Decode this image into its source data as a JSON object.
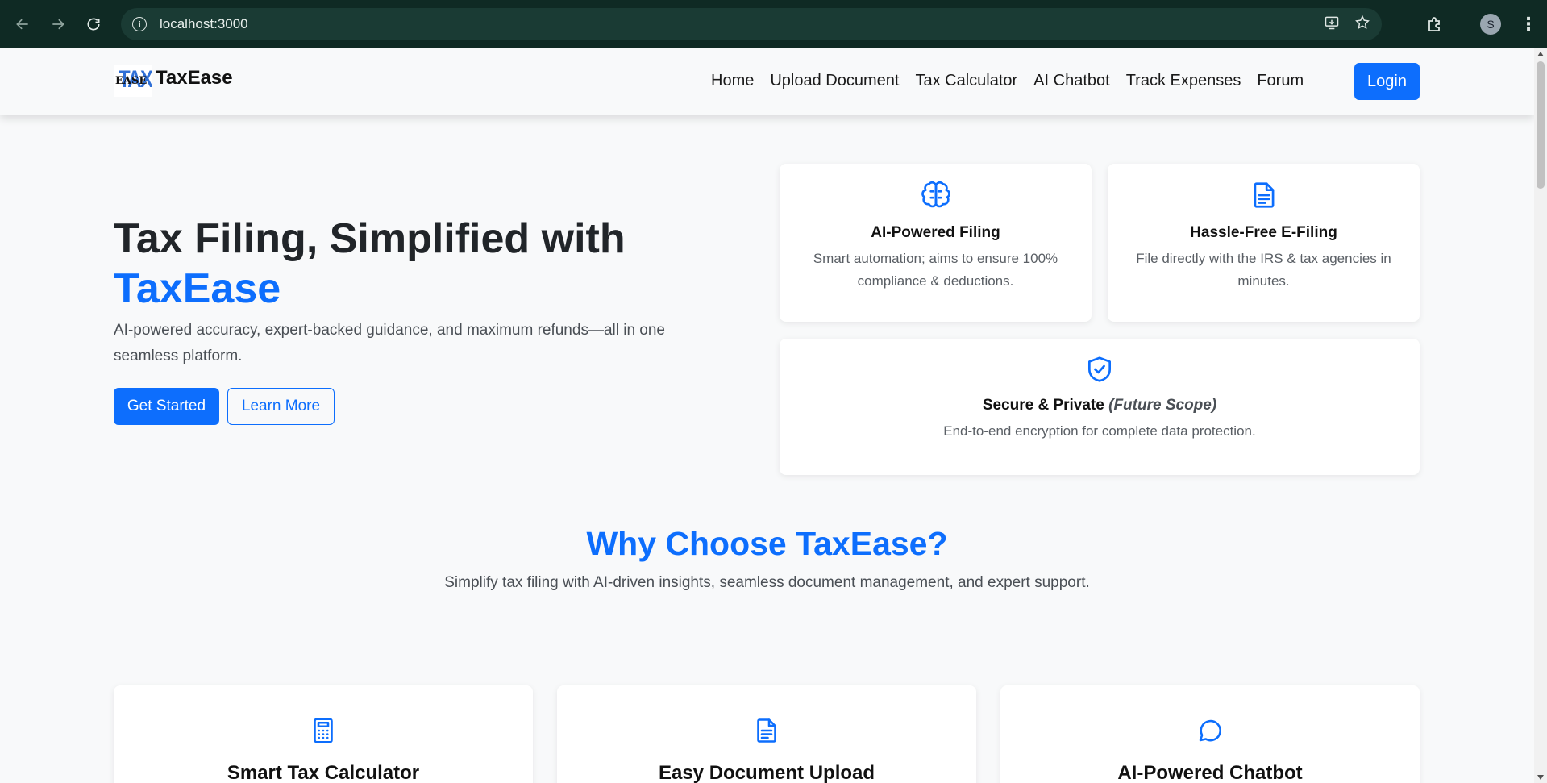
{
  "browser": {
    "url": "localhost:3000",
    "avatar_letter": "S"
  },
  "header": {
    "brand_logo_tax": "TAX",
    "brand_logo_ease": "EASE",
    "brand_name": "TaxEase",
    "nav": [
      "Home",
      "Upload Document",
      "Tax Calculator",
      "AI Chatbot",
      "Track Expenses",
      "Forum"
    ],
    "login_label": "Login"
  },
  "hero": {
    "title_line1": "Tax Filing, Simplified with",
    "title_accent": "TaxEase",
    "subtitle": "AI-powered accuracy, expert-backed guidance, and maximum refunds—all in one seamless platform.",
    "primary_button": "Get Started",
    "secondary_button": "Learn More"
  },
  "hero_cards": [
    {
      "title": "AI-Powered Filing",
      "desc": "Smart automation; aims to ensure 100% compliance & deductions.",
      "icon": "brain-icon"
    },
    {
      "title": "Hassle-Free E-Filing",
      "desc": "File directly with the IRS & tax agencies in minutes.",
      "icon": "document-icon"
    },
    {
      "title": "Secure & Private",
      "title_note": "(Future Scope)",
      "desc": "End-to-end encryption for complete data protection.",
      "icon": "shield-check-icon"
    }
  ],
  "why": {
    "title": "Why Choose TaxEase?",
    "subtitle": "Simplify tax filing with AI-driven insights, seamless document management, and expert support.",
    "features": [
      {
        "title": "Smart Tax Calculator",
        "icon": "calculator-icon"
      },
      {
        "title": "Easy Document Upload",
        "icon": "document-icon"
      },
      {
        "title": "AI-Powered Chatbot",
        "icon": "chat-bubble-icon"
      }
    ]
  },
  "colors": {
    "accent": "#0d6efd",
    "page_bg": "#f8f9fa",
    "chrome_bg": "#0f2a24"
  }
}
